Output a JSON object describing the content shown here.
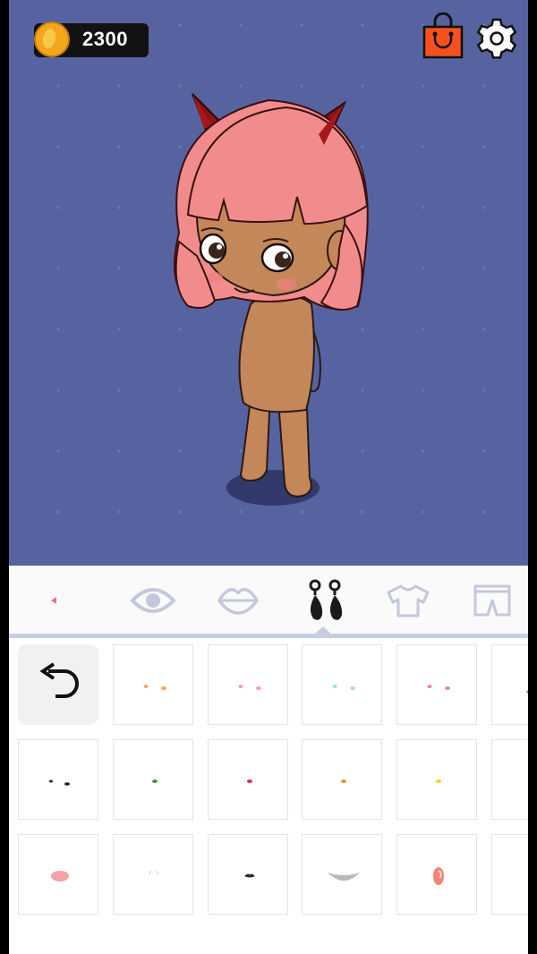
{
  "header": {
    "coins": "2300",
    "coin_icon": "gold-coin-icon",
    "shop_icon": "shopping-bag-icon",
    "settings_icon": "gear-icon"
  },
  "colors": {
    "background": "#5663a0",
    "shop": "#f5511e",
    "hair": "#f28c8c",
    "skin": "#c4875a",
    "horns": "#8b1212",
    "tab_inactive": "#c4c8dc",
    "tab_active": "#1a1a1a"
  },
  "tabs": [
    {
      "name": "back",
      "icon": "left-arrow-icon",
      "active": false
    },
    {
      "name": "eyes",
      "icon": "eye-icon",
      "active": false
    },
    {
      "name": "lips",
      "icon": "lips-icon",
      "active": false
    },
    {
      "name": "earrings",
      "icon": "earrings-icon",
      "active": true
    },
    {
      "name": "tops",
      "icon": "shirt-icon",
      "active": false
    },
    {
      "name": "bottoms",
      "icon": "shorts-icon",
      "active": false
    }
  ],
  "grid": {
    "undo_icon": "undo-icon",
    "items": [
      {
        "row": 0,
        "col": 1,
        "kind": "pair",
        "color": "#f0a860"
      },
      {
        "row": 0,
        "col": 2,
        "kind": "pair",
        "color": "#f0a0b8"
      },
      {
        "row": 0,
        "col": 3,
        "kind": "pair",
        "color": "#a0e0e0"
      },
      {
        "row": 0,
        "col": 4,
        "kind": "pair",
        "color": "#e88888"
      },
      {
        "row": 0,
        "col": 5,
        "kind": "dot",
        "color": "#e07070"
      },
      {
        "row": 1,
        "col": 0,
        "kind": "pair-dark",
        "color": "#222222"
      },
      {
        "row": 1,
        "col": 1,
        "kind": "single",
        "color": "#3a9a3a"
      },
      {
        "row": 1,
        "col": 2,
        "kind": "single",
        "color": "#d83050"
      },
      {
        "row": 1,
        "col": 3,
        "kind": "single",
        "color": "#f09030"
      },
      {
        "row": 1,
        "col": 4,
        "kind": "single",
        "color": "#f0d020"
      },
      {
        "row": 1,
        "col": 5,
        "kind": "empty",
        "color": ""
      },
      {
        "row": 2,
        "col": 0,
        "kind": "blush",
        "color": "#f06070"
      },
      {
        "row": 2,
        "col": 1,
        "kind": "faint",
        "color": "#d0d0d0"
      },
      {
        "row": 2,
        "col": 2,
        "kind": "mustache",
        "color": "#222222"
      },
      {
        "row": 2,
        "col": 3,
        "kind": "beard",
        "color": "#b8b8b8"
      },
      {
        "row": 2,
        "col": 4,
        "kind": "splash",
        "color": "#f05040"
      },
      {
        "row": 2,
        "col": 5,
        "kind": "empty",
        "color": ""
      }
    ]
  }
}
